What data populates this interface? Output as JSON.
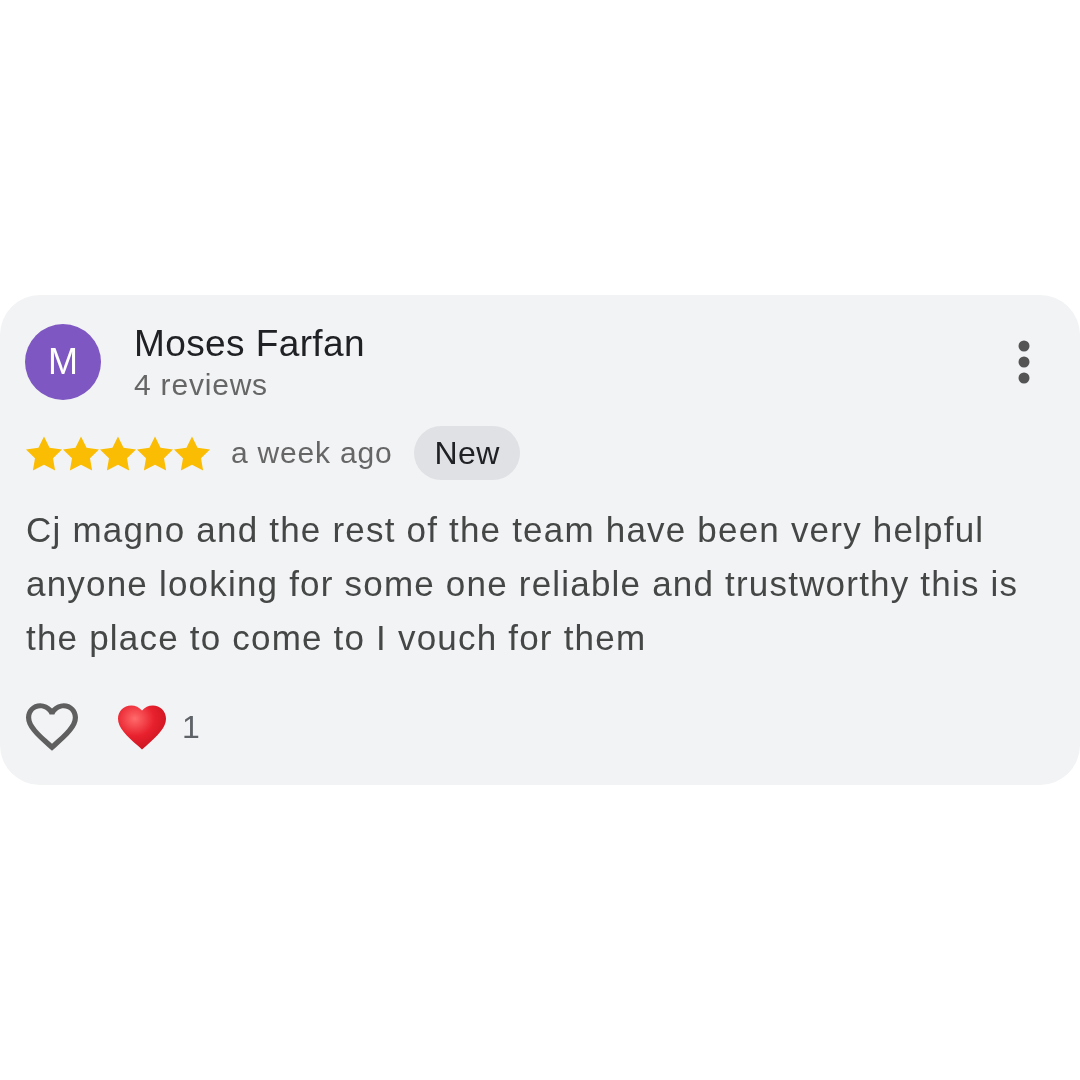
{
  "review": {
    "avatar_letter": "M",
    "author": "Moses Farfan",
    "author_meta": "4 reviews",
    "stars": 5,
    "time": "a week ago",
    "badge": "New",
    "text": "Cj magno and the rest of the team have been very helpful anyone looking for some one reliable and trustworthy this is the place to come to I vouch for them"
  },
  "actions": {
    "liked": false,
    "reaction_count": "1"
  }
}
